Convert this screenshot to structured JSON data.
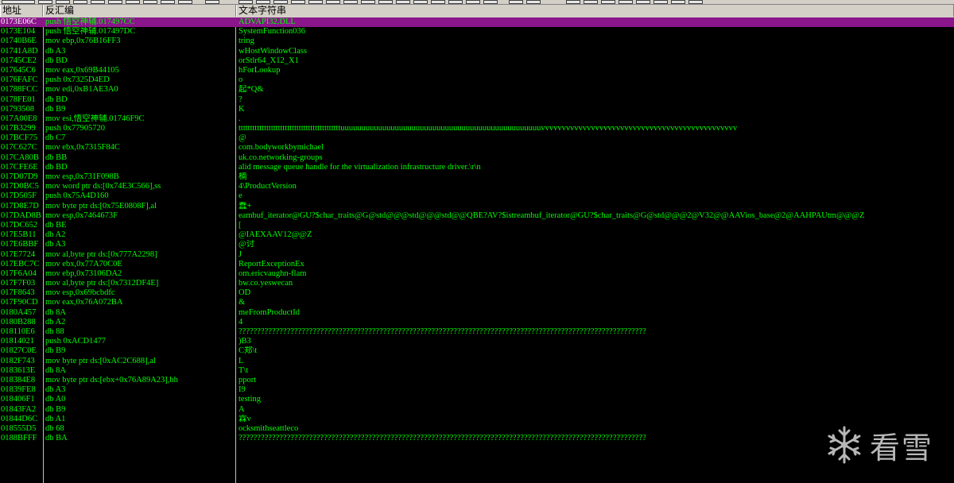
{
  "header": {
    "col_address": "地址",
    "col_disasm": "反汇编",
    "col_string": "文本字符串"
  },
  "rows": [
    {
      "addr": "0173E06C",
      "dis": "push 悟空神辅.017497CC",
      "str": "ADVAPI32.DLL",
      "selected": true
    },
    {
      "addr": "0173E104",
      "dis": "push 悟空神辅.017497DC",
      "str": "SystemFunction036"
    },
    {
      "addr": "01740B6E",
      "dis": "mov ebp,0x76B16FF3",
      "str": "tring"
    },
    {
      "addr": "01741A8D",
      "dis": "db A3",
      "str": "wHostWindowClass"
    },
    {
      "addr": "01745CE2",
      "dis": "db BD",
      "str": "orStlr64_X12_X1"
    },
    {
      "addr": "017645C6",
      "dis": "mov eax,0x69B44105",
      "str": "hForLookup"
    },
    {
      "addr": "0176FAFC",
      "dis": "push 0x7325D4ED",
      "str": "o"
    },
    {
      "addr": "01788FCC",
      "dis": "mov edi,0xB1AE3A0",
      "str": "起*Q&"
    },
    {
      "addr": "0178FE01",
      "dis": "db BD",
      "str": "?"
    },
    {
      "addr": "01793508",
      "dis": "db B9",
      "str": "K"
    },
    {
      "addr": "017A00E8",
      "dis": "mov esi,悟空神辅.01746F9C",
      "str": "."
    },
    {
      "addr": "017B3299",
      "dis": "push 0x77905720",
      "str": "ttttttttttttttttttttttttttttttttttttttttttttuuuuuuuuuuuuuuuuuuuuuuuuuuuuuuuuuuuuuuuuuuuuuuuuvvvvvvvvvvvvvvvvvvvvvvvvvvvvvvvvvvvvvvvvvvvvvvv"
    },
    {
      "addr": "017BCF75",
      "dis": "db C7",
      "str": "@"
    },
    {
      "addr": "017C627C",
      "dis": "mov ebx,0x7315F84C",
      "str": "com.bodyworkbymichael"
    },
    {
      "addr": "017CA80B",
      "dis": "db BB",
      "str": "uk.co.networking-groups"
    },
    {
      "addr": "017CFE6E",
      "dis": "db BD",
      "str": "alid message queue handle for the virtualization infrastructure driver.\\r\\n"
    },
    {
      "addr": "017D07D9",
      "dis": "mov esp,0x731F098B",
      "str": "楠"
    },
    {
      "addr": "017D0BC5",
      "dis": "mov word ptr ds:[0x74E3C566],ss",
      "str": "4\\ProductVersion"
    },
    {
      "addr": "017D505F",
      "dis": "push 0x75A4D160",
      "str": "e"
    },
    {
      "addr": "017D8E7D",
      "dis": "mov byte ptr ds:[0x75E0808F],al",
      "str": "蠢+"
    },
    {
      "addr": "017DAD8B",
      "dis": "mov esp,0x7464673F",
      "str": "eambuf_iterator@GU?$char_traits@G@std@@@std@@@std@@QBE?AV?$istreambuf_iterator@GU?$char_traits@G@std@@@2@V32@@AAVios_base@2@AAHPAUtm@@@Z"
    },
    {
      "addr": "017DC652",
      "dis": "db BE",
      "str": "["
    },
    {
      "addr": "017E5B11",
      "dis": "db A2",
      "str": "@IAEXAAV12@@Z"
    },
    {
      "addr": "017E6BBF",
      "dis": "db A3",
      "str": "@讨"
    },
    {
      "addr": "017E7724",
      "dis": "mov al,byte ptr ds:[0x777A2298]",
      "str": "J"
    },
    {
      "addr": "017EBC7C",
      "dis": "mov ebx,0x77A70C0E",
      "str": "ReportExceptionEx"
    },
    {
      "addr": "017F6A04",
      "dis": "mov ebp,0x73106DA2",
      "str": "om.ericvaughn-flam"
    },
    {
      "addr": "017F7F03",
      "dis": "mov al,byte ptr ds:[0x7312DF4E]",
      "str": "bw.co.yeswecan"
    },
    {
      "addr": "017F8643",
      "dis": "mov esp,0x69bcbdfc",
      "str": "OD"
    },
    {
      "addr": "017F90CD",
      "dis": "mov eax,0x76A072BA",
      "str": "&"
    },
    {
      "addr": "0180A457",
      "dis": "db 8A",
      "str": "meFromProductId"
    },
    {
      "addr": "0180B288",
      "dis": "db A2",
      "str": "4"
    },
    {
      "addr": "018110E6",
      "dis": "db 88",
      "str": "??????????????????????????????????????????????????????????????????????????????????????????????????????????????"
    },
    {
      "addr": "01814021",
      "dis": "push 0xACD1477",
      "str": ")B3"
    },
    {
      "addr": "01827C0E",
      "dis": "db B9",
      "str": "C郑\\t"
    },
    {
      "addr": "0182F743",
      "dis": "mov byte ptr ds:[0xAC2C688],al",
      "str": "L"
    },
    {
      "addr": "0183613E",
      "dis": "db 8A",
      "str": " T\\t"
    },
    {
      "addr": "018384E8",
      "dis": "mov byte ptr ds:[ebx+0x76A89A23],bh",
      "str": "pport"
    },
    {
      "addr": "01839FE8",
      "dis": "db A3",
      "str": "I9"
    },
    {
      "addr": "018406F1",
      "dis": "db A0",
      "str": "testing"
    },
    {
      "addr": "01843FA2",
      "dis": "db B9",
      "str": "A"
    },
    {
      "addr": "01844D6C",
      "dis": "db A1",
      "str": "霖v"
    },
    {
      "addr": "018555D5",
      "dis": "db 68",
      "str": "ocksmithseattleco"
    },
    {
      "addr": "0188BFFF",
      "dis": "db BA",
      "str": "??????????????????????????????????????????????????????????????????????????????????????????????????????????????"
    }
  ],
  "watermark": {
    "text": "看雪",
    "icon": "snowflake-logo"
  },
  "colors": {
    "background": "#000000",
    "text": "#00ff00",
    "selected_row": "#8b158b",
    "header_bg": "#d4d0c8"
  }
}
